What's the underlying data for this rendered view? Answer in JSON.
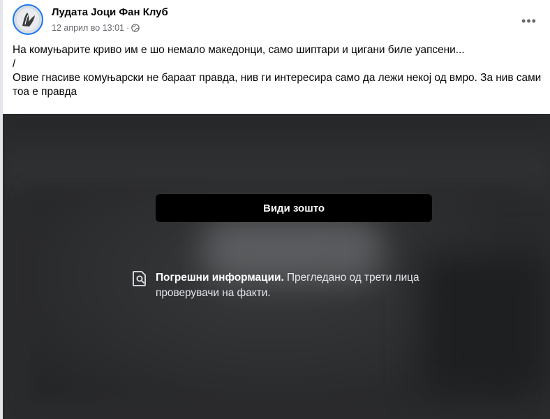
{
  "post": {
    "page_name": "Лудата Јоци Фан Клуб",
    "timestamp": "12 април во 13:01",
    "separator": "·",
    "privacy_icon": "globe-icon",
    "more_icon": "more-options-icon",
    "more_label": "•••",
    "text_lines": [
      "На комуњарите криво им е шо немало македонци, само шиптари и цигани биле уапсени...",
      "/",
      "Овие гнасиве комуњарски не бараат правда, нив ги интересира само да лежи некој од вмро. За нив сами тоа е правда"
    ]
  },
  "media_overlay": {
    "icon": "fact-check-icon",
    "warning_title": "Погрешни информации.",
    "warning_body": "Прегледано од трети лица проверувачи на факти.",
    "button_label": "Види зошто"
  },
  "colors": {
    "accent": "#1877f2",
    "text_primary": "#050505",
    "text_secondary": "#65676b",
    "overlay_bg": "#2a2b2d",
    "button_bg": "#000000"
  }
}
